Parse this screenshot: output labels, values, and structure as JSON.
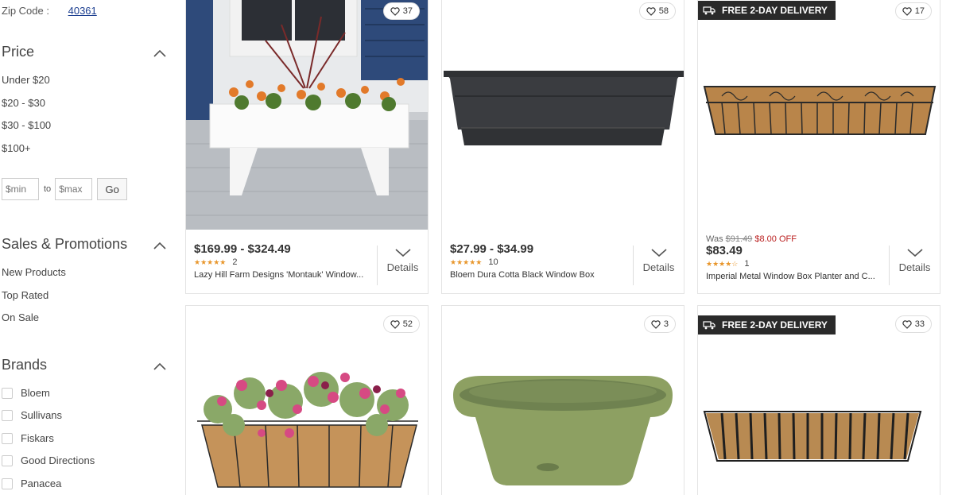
{
  "zip": {
    "label": "Zip Code :",
    "value": "40361"
  },
  "price_filter": {
    "title": "Price",
    "options": [
      "Under $20",
      "$20 - $30",
      "$30 - $100",
      "$100+"
    ],
    "min_placeholder": "$min",
    "to_label": "to",
    "max_placeholder": "$max",
    "go_label": "Go"
  },
  "sales_filter": {
    "title": "Sales & Promotions",
    "options": [
      "New Products",
      "Top Rated",
      "On Sale"
    ]
  },
  "brands_filter": {
    "title": "Brands",
    "options": [
      "Bloem",
      "Sullivans",
      "Fiskars",
      "Good Directions",
      "Panacea"
    ]
  },
  "products": [
    {
      "favorites": "37",
      "price": "$169.99 - $324.49",
      "rating": 5,
      "reviews": "2",
      "name": "Lazy Hill Farm Designs 'Montauk' Window...",
      "details_label": "Details"
    },
    {
      "favorites": "58",
      "price": "$27.99 - $34.99",
      "rating": 4.5,
      "reviews": "10",
      "name": "Bloem Dura Cotta Black Window Box",
      "details_label": "Details"
    },
    {
      "favorites": "17",
      "badge": "FREE 2-DAY DELIVERY",
      "was_label": "Was",
      "was_price": "$91.49",
      "discount": "$8.00 OFF",
      "price": "$83.49",
      "rating": 4,
      "reviews": "1",
      "name": "Imperial Metal Window Box Planter and C...",
      "details_label": "Details"
    },
    {
      "favorites": "52"
    },
    {
      "favorites": "3"
    },
    {
      "favorites": "33",
      "badge": "FREE 2-DAY DELIVERY"
    }
  ],
  "colors": {
    "link": "#1a3d8f",
    "star": "#e8962b",
    "badge_bg": "#2a2a2a",
    "discount": "#b22222"
  }
}
